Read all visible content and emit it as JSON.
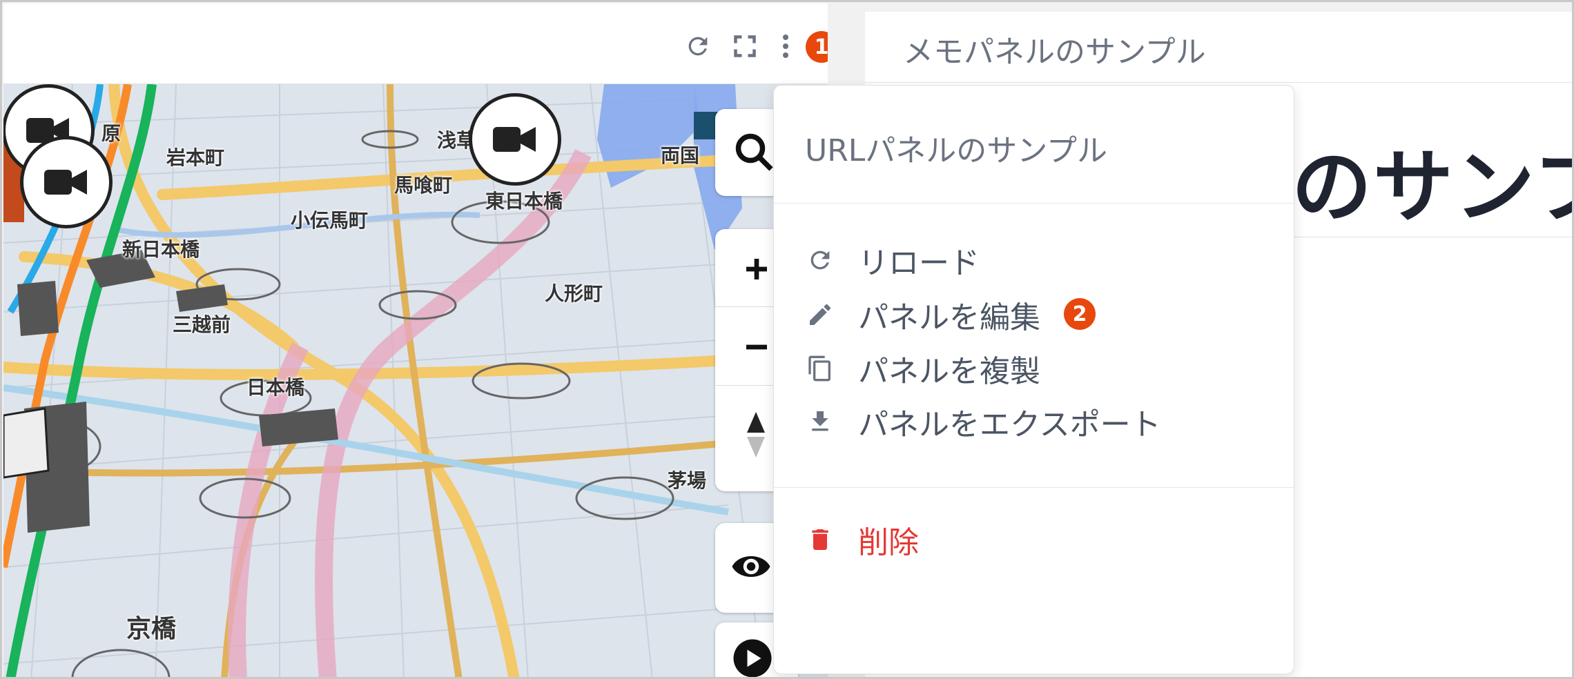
{
  "map_panel": {
    "header": {
      "reload_icon": "reload-icon",
      "fullscreen_icon": "fullscreen-icon",
      "menu_icon": "more-vertical-icon",
      "callout": "1"
    },
    "labels": {
      "iwamotocho": "岩本町",
      "bakurocho": "馬喰町",
      "higashi_nihonbashi": "東日本橋",
      "asakusabashi": "浅草",
      "ryogoku": "両国",
      "kodenmacho": "小伝馬町",
      "shin_nihonbashi": "新日本橋",
      "ningyocho": "人形町",
      "mitsukoshimae": "三越前",
      "nihonbashi": "日本橋",
      "kayabacho": "茅場",
      "kyobashi": "京橋",
      "akihabara_partial": "原"
    },
    "controls": [
      "search-icon",
      "zoom-in-icon",
      "zoom-out-icon",
      "compass-icon",
      "eye-icon",
      "play-icon"
    ]
  },
  "memo_panel": {
    "title": "メモパネルのサンプル",
    "heading_partial": "のサンプ"
  },
  "menu": {
    "title": "URLパネルのサンプル",
    "items": [
      {
        "label": "リロード",
        "icon": "reload-icon"
      },
      {
        "label": "パネルを編集",
        "icon": "pencil-icon",
        "callout": "2"
      },
      {
        "label": "パネルを複製",
        "icon": "copy-icon"
      },
      {
        "label": "パネルをエクスポート",
        "icon": "download-icon"
      },
      {
        "label": "削除",
        "icon": "trash-icon",
        "danger": true
      }
    ]
  },
  "colors": {
    "accent_callout": "#e8480c",
    "danger": "#e53935",
    "menu_text": "#4b5563"
  }
}
